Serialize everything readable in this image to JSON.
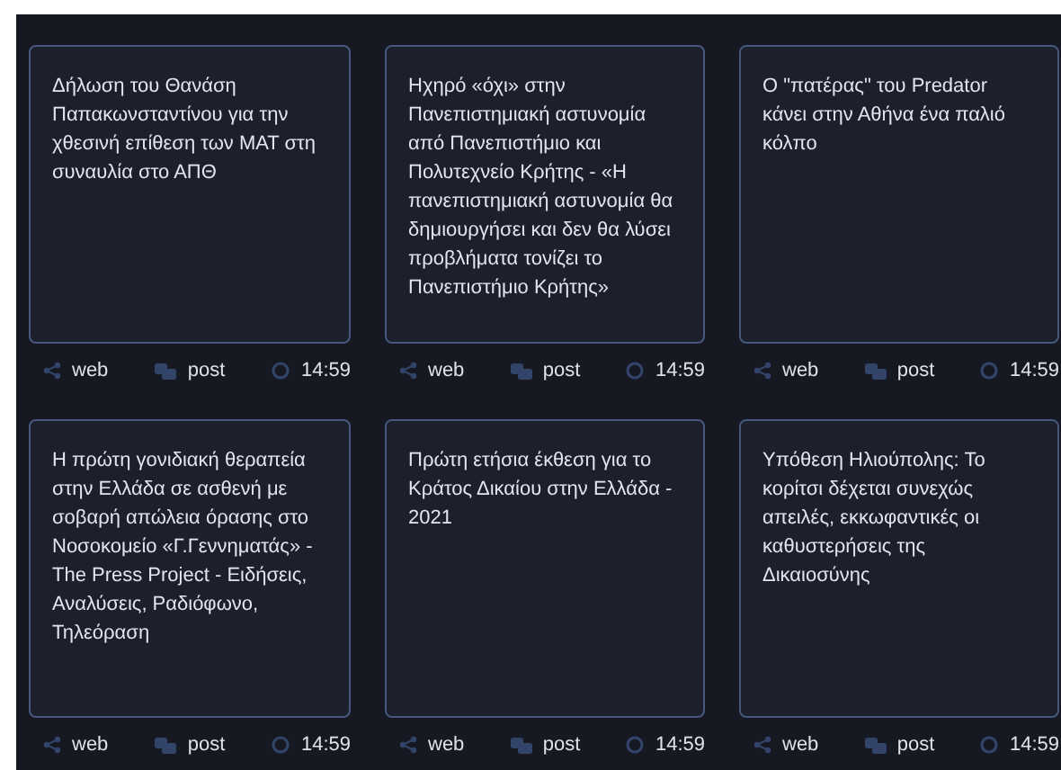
{
  "articles": [
    {
      "title": "Δήλωση του Θανάση Παπακωνσταντίνου για την χθεσινή επίθεση των ΜΑΤ στη συναυλία στο ΑΠΘ",
      "source": "web",
      "type": "post",
      "time": "14:59"
    },
    {
      "title": "Ηχηρό «όχι» στην Πανεπιστημιακή αστυνομία από Πανεπιστήμιο και Πολυτεχνείο Κρήτης - «Η πανεπιστημιακή αστυνομία θα δημιουργήσει και δεν θα λύσει προβλήματα τονίζει το Πανεπιστήμιο Κρήτης»",
      "source": "web",
      "type": "post",
      "time": "14:59"
    },
    {
      "title": "Ο \"πατέρας\" του Predator κάνει στην Αθήνα ένα παλιό κόλπο",
      "source": "web",
      "type": "post",
      "time": "14:59"
    },
    {
      "title": "Η πρώτη γονιδιακή θεραπεία στην Ελλάδα σε ασθενή με σοβαρή απώλεια όρασης στο Νοσοκομείο «Γ.Γεννηματάς» - The Press Project - Ειδήσεις, Αναλύσεις, Ραδιόφωνο, Τηλεόραση",
      "source": "web",
      "type": "post",
      "time": "14:59"
    },
    {
      "title": "Πρώτη ετήσια έκθεση για το Κράτος Δικαίου στην Ελλάδα - 2021",
      "source": "web",
      "type": "post",
      "time": "14:59"
    },
    {
      "title": "Υπόθεση Ηλιούπολης: Το κορίτσι δέχεται συνεχώς απειλές, εκκωφαντικές οι καθυστερήσεις της Δικαιοσύνης",
      "source": "web",
      "type": "post",
      "time": "14:59"
    }
  ]
}
